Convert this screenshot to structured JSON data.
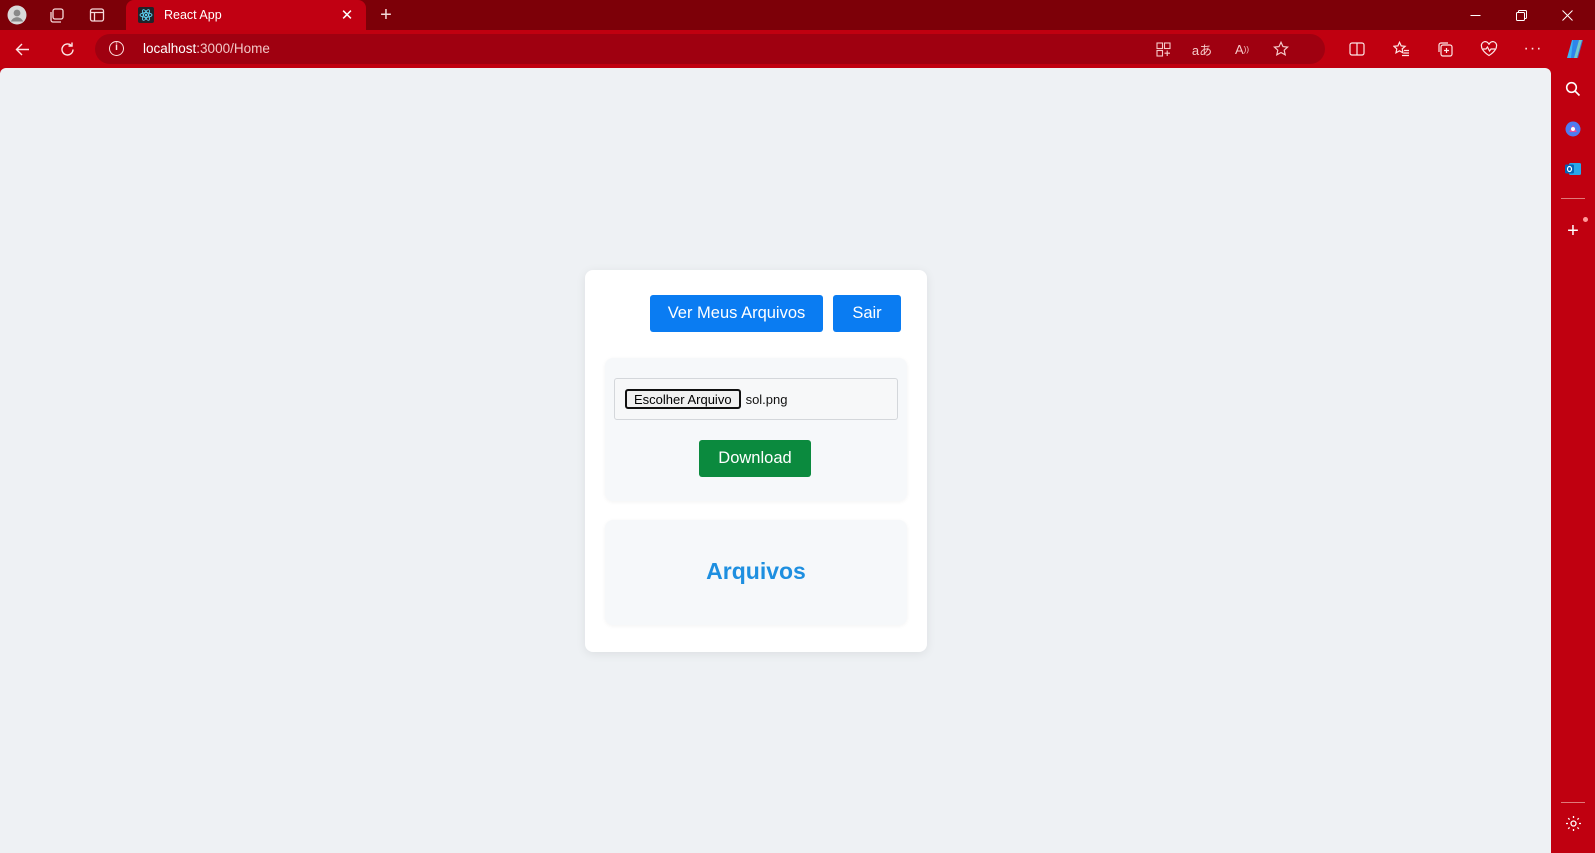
{
  "browser": {
    "tab": {
      "title": "React App",
      "favicon": "react-icon"
    },
    "address": {
      "host": "localhost",
      "path": ":3000/Home"
    },
    "colors": {
      "frame": "#c00010",
      "tabstrip": "#7d0008"
    }
  },
  "page": {
    "header_buttons": {
      "view_files": "Ver Meus Arquivos",
      "logout": "Sair"
    },
    "upload": {
      "choose_file_label": "Escolher Arquivo",
      "selected_file": "sol.png",
      "download_label": "Download"
    },
    "files_section": {
      "title": "Arquivos"
    },
    "colors": {
      "primary_button": "#0a7cf2",
      "success_button": "#0b8a3e",
      "title_text": "#1e8fe0",
      "background": "#eef1f4"
    }
  }
}
